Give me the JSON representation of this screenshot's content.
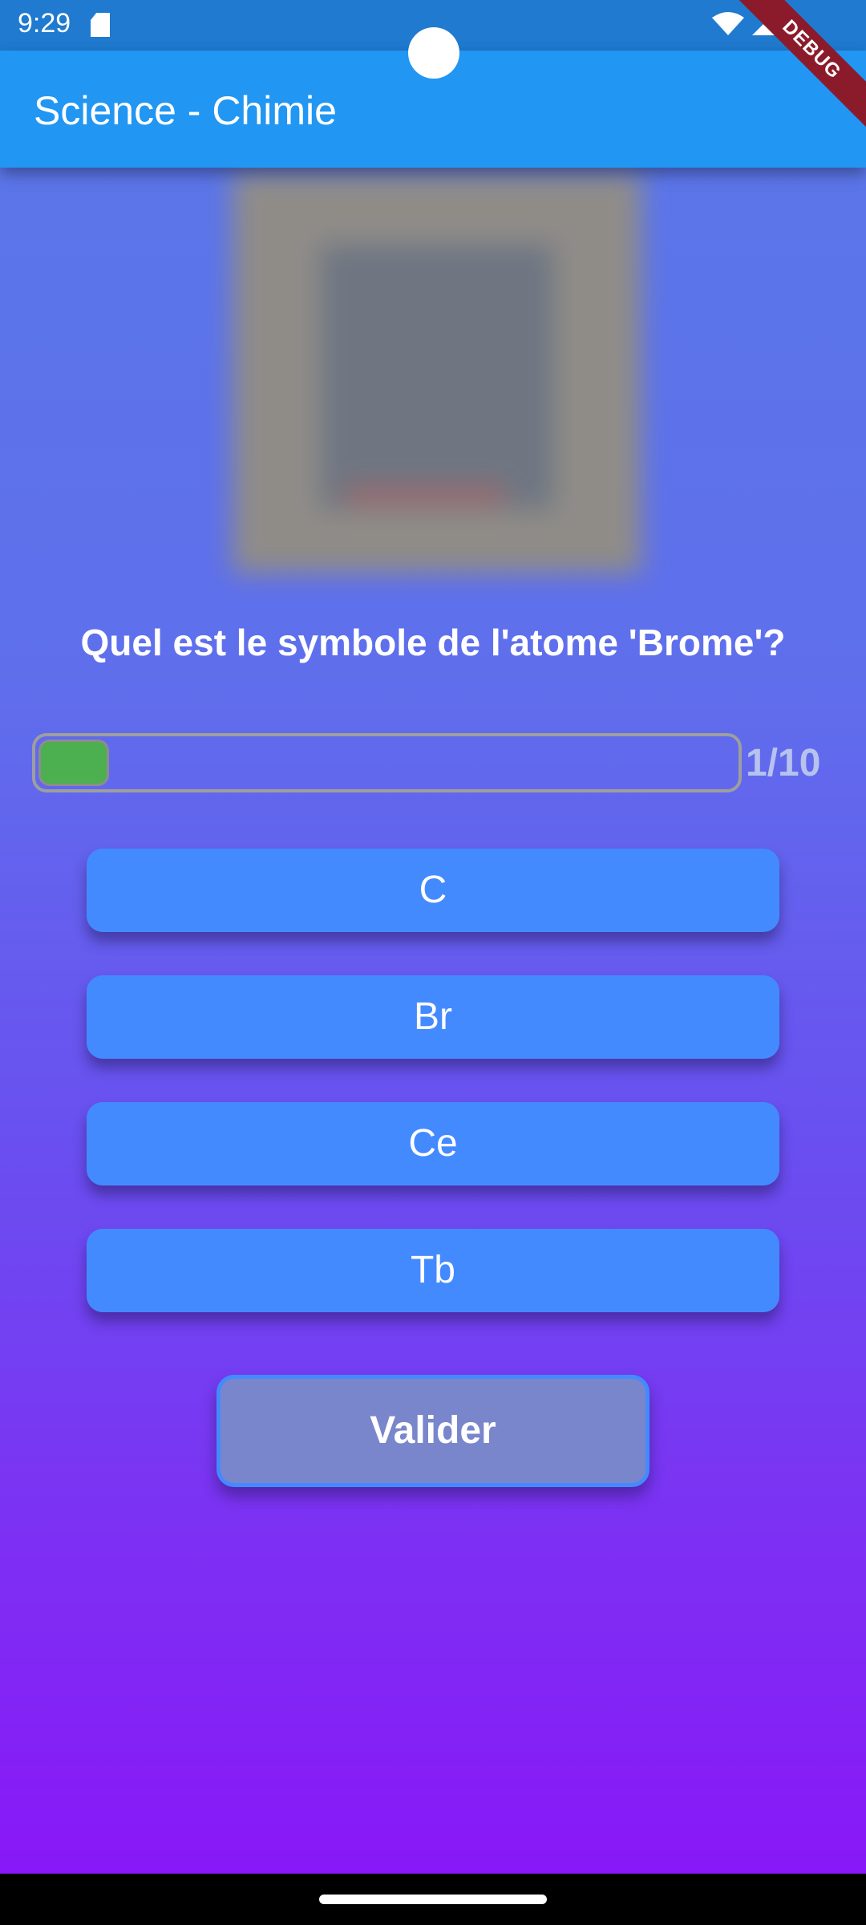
{
  "status_bar": {
    "time": "9:29",
    "icons": [
      "sd-card-icon",
      "wifi-icon",
      "signal-icon"
    ]
  },
  "app_bar": {
    "title": "Science - Chimie"
  },
  "debug_banner": {
    "label": "DEBUG"
  },
  "quiz": {
    "question": "Quel est le symbole de l'atome 'Brome'?",
    "progress": {
      "current": 1,
      "total": 10,
      "label": "1/10"
    },
    "answers": [
      {
        "label": "C"
      },
      {
        "label": "Br"
      },
      {
        "label": "Ce"
      },
      {
        "label": "Tb"
      }
    ],
    "validate_label": "Valider"
  },
  "colors": {
    "app_bar": "#2196f3",
    "status_bar": "#1f7ad0",
    "answer_button": "#448aff",
    "validate_button": "#7986cb",
    "progress_fill": "#4caf50"
  }
}
